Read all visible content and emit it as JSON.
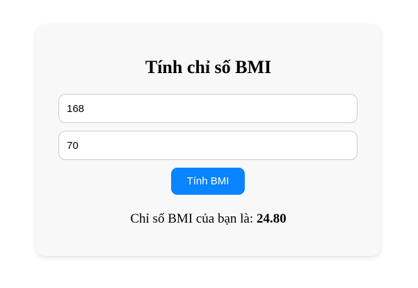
{
  "form": {
    "title": "Tính chỉ số BMI",
    "height_value": "168",
    "weight_value": "70",
    "button_label": "Tính BMI"
  },
  "result": {
    "label": "Chỉ số BMI của bạn là: ",
    "value": "24.80"
  },
  "colors": {
    "accent": "#0a84ff",
    "card_background": "#f8f8f8"
  }
}
